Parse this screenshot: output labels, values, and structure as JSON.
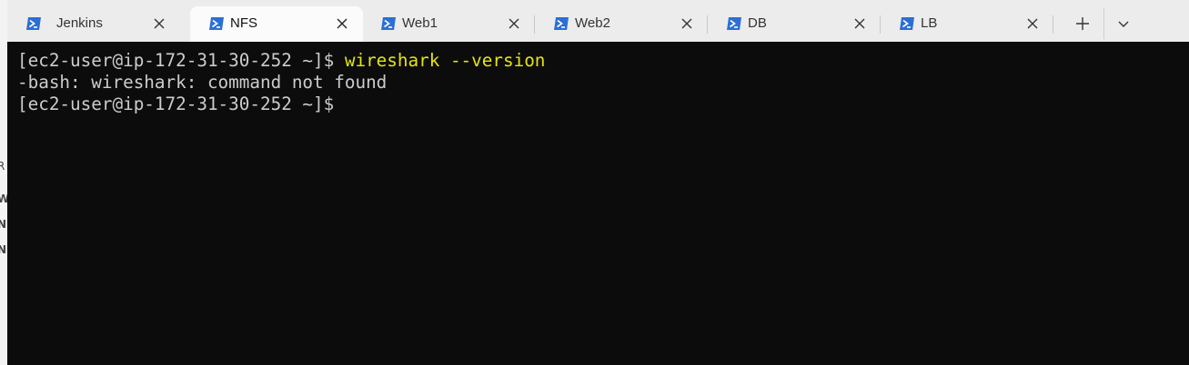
{
  "tabs": [
    {
      "label": "Jenkins",
      "active": false
    },
    {
      "label": "NFS",
      "active": true
    },
    {
      "label": "Web1",
      "active": false
    },
    {
      "label": "Web2",
      "active": false
    },
    {
      "label": "DB",
      "active": false
    },
    {
      "label": "LB",
      "active": false
    }
  ],
  "tab_icon": "powershell-icon",
  "tab_close_icon": "close-icon",
  "new_tab_icon": "plus-icon",
  "dropdown_icon": "chevron-down-icon",
  "colors": {
    "accent_icon": "#2b6fd6",
    "command_text": "#e5e510",
    "terminal_text": "#cccccc",
    "terminal_bg": "#0c0c0c"
  },
  "terminal": {
    "line1_prompt": "[ec2-user@ip-172-31-30-252 ~]$ ",
    "line1_command": "wireshark --version",
    "line2_output": "-bash: wireshark: command not found",
    "line3_prompt": "[ec2-user@ip-172-31-30-252 ~]$"
  },
  "left_strip": {
    "fragments": [
      "R",
      "W",
      "N",
      "N"
    ]
  }
}
